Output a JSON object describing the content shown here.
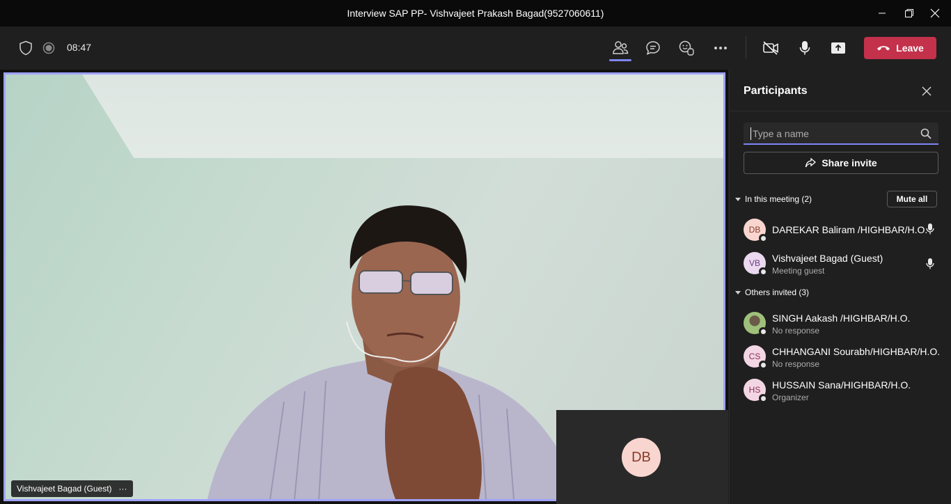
{
  "window": {
    "title": "Interview SAP PP- Vishvajeet Prakash Bagad(9527060611)"
  },
  "toolbar": {
    "timer": "08:47",
    "leave_label": "Leave",
    "icons": [
      "shield-icon",
      "recording-icon",
      "people-icon",
      "chat-icon",
      "reactions-icon",
      "more-icon",
      "camera-off-icon",
      "mic-icon",
      "share-screen-icon",
      "phone-hangup-icon"
    ],
    "accent": "#7f85f5",
    "leave_color": "#c4314b"
  },
  "stage": {
    "main_video_name": "Vishvajeet Bagad (Guest)",
    "more_label": "···",
    "self_initials": "DB"
  },
  "participants": {
    "title": "Participants",
    "search_placeholder": "Type a name",
    "share_invite": "Share invite",
    "in_meeting_header": "In this meeting (2)",
    "mute_all": "Mute all",
    "others_header": "Others invited (3)",
    "in_meeting": [
      {
        "initials": "DB",
        "name": "DAREKAR Baliram /HIGHBAR/H.O.",
        "sub": ""
      },
      {
        "initials": "VB",
        "name": "Vishvajeet Bagad (Guest)",
        "sub": "Meeting guest"
      }
    ],
    "others": [
      {
        "initials": "",
        "name": "SINGH Aakash /HIGHBAR/H.O.",
        "sub": "No response"
      },
      {
        "initials": "CS",
        "name": "CHHANGANI Sourabh/HIGHBAR/H.O.",
        "sub": "No response"
      },
      {
        "initials": "HS",
        "name": "HUSSAIN Sana/HIGHBAR/H.O.",
        "sub": "Organizer"
      }
    ]
  }
}
